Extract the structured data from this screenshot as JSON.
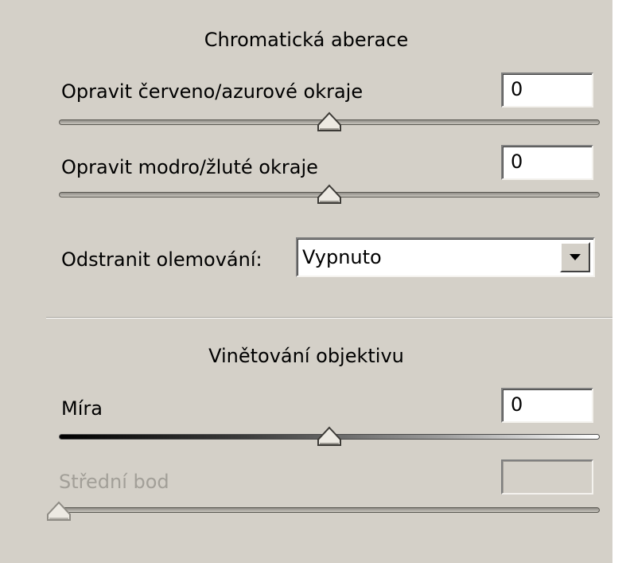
{
  "chromatic": {
    "heading": "Chromatická aberace",
    "red_cyan": {
      "label": "Opravit červeno/azurové okraje",
      "value": "0",
      "slider_fraction": 0.5
    },
    "blue_yellow": {
      "label": "Opravit modro/žluté okraje",
      "value": "0",
      "slider_fraction": 0.5
    },
    "defringe": {
      "label": "Odstranit olemování:",
      "selected": "Vypnuto"
    }
  },
  "vignetting": {
    "heading": "Vinětování objektivu",
    "amount": {
      "label": "Míra",
      "value": "0",
      "slider_fraction": 0.5
    },
    "midpoint": {
      "label": "Střední bod",
      "value": "",
      "slider_fraction": 0.0,
      "enabled": false
    }
  },
  "icons": {
    "dropdown": "triangle-down-icon",
    "slider_thumb": "triangle-thumb-icon"
  },
  "colors": {
    "panel": "#d4d0c8",
    "disabled_text": "#a29f98"
  }
}
